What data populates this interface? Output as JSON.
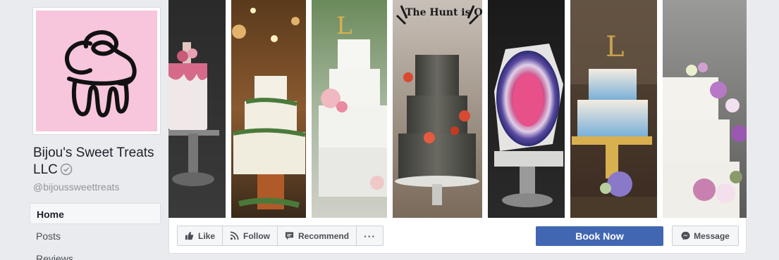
{
  "page": {
    "name": "Bijou's Sweet Treats LLC",
    "handle": "@bijoussweettreats",
    "verified": true,
    "logo_bg": "#f7c5dc"
  },
  "nav": {
    "items": [
      {
        "label": "Home",
        "active": true
      },
      {
        "label": "Posts",
        "active": false
      },
      {
        "label": "Reviews",
        "active": false
      }
    ]
  },
  "cover": {
    "images": [
      "cake-photo-1",
      "cake-photo-2",
      "cake-photo-3",
      "cake-photo-4",
      "cake-photo-5",
      "cake-photo-6",
      "cake-photo-7"
    ],
    "topper_text": "The Hunt is Over"
  },
  "actions": {
    "like": "Like",
    "follow": "Follow",
    "recommend": "Recommend",
    "more": "···",
    "book": "Book Now",
    "message": "Message"
  },
  "colors": {
    "accent": "#4267b2",
    "background": "#e9ebee"
  }
}
